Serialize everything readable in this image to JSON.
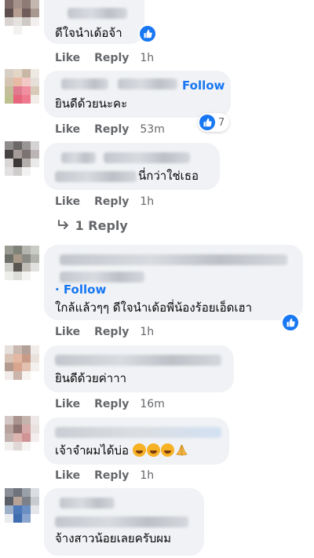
{
  "comments": [
    {
      "text": "ดีใจนำเด้อจ้า",
      "like": "Like",
      "reply": "Reply",
      "time": "1h"
    },
    {
      "follow": "Follow",
      "text": "ยินดีด้วยนะคะ",
      "like": "Like",
      "reply": "Reply",
      "time": "53m",
      "reaction_count": "7"
    },
    {
      "text": "นี่กว่าใช่เธอ",
      "like": "Like",
      "reply": "Reply",
      "time": "1h",
      "replies_label": "1 Reply"
    },
    {
      "follow": "· Follow",
      "text": "ใกล้แล้วๆๆ ดีใจนำเด้อพี่น้องร้อยเอ็ดเฮา",
      "like": "Like",
      "reply": "Reply",
      "time": "1h"
    },
    {
      "text": "ยินดีด้วยค่าาา",
      "like": "Like",
      "reply": "Reply",
      "time": "16m"
    },
    {
      "text": "เจ้าจำผมได้บ่อ",
      "like": "Like",
      "reply": "Reply",
      "time": "1h"
    },
    {
      "text": "จ้างสาวน้อยเลยครับผม"
    }
  ],
  "colors": {
    "accent": "#1877f2",
    "bubble": "#f0f2f5",
    "meta": "#65676b"
  },
  "icons": {
    "like": "thumbs-up-icon",
    "reply_arrow": "reply-arrow-icon",
    "emoji": "laughing-emoji-icon",
    "pray": "praying-hands-emoji-icon"
  }
}
